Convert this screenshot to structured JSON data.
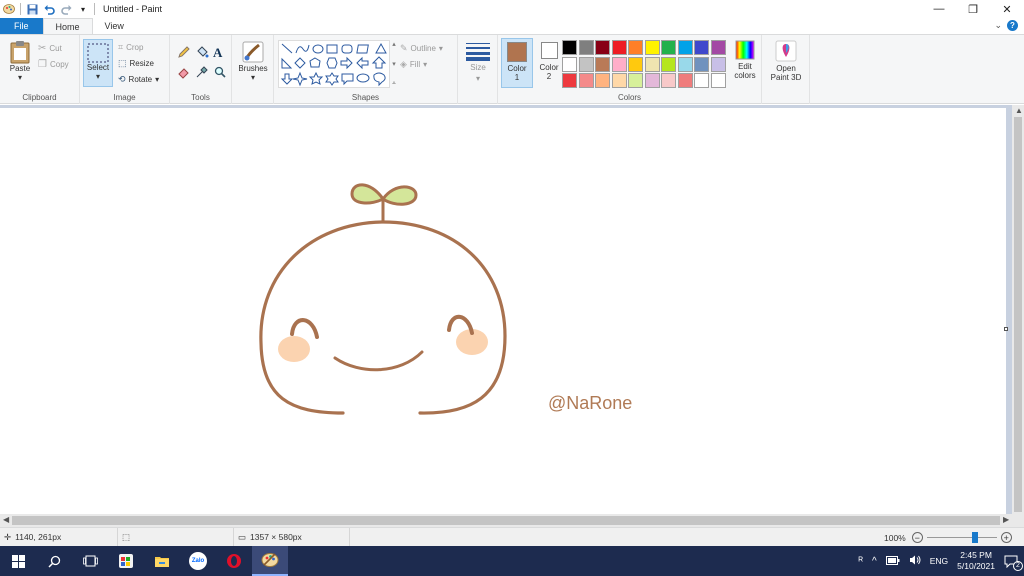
{
  "window": {
    "title": "Untitled - Paint",
    "minimize_glyph": "—",
    "restore_glyph": "❐",
    "close_glyph": "✕"
  },
  "tabs": {
    "file": "File",
    "home": "Home",
    "view": "View"
  },
  "ribbon": {
    "clipboard": {
      "label": "Clipboard",
      "paste": "Paste",
      "cut": "Cut",
      "copy": "Copy"
    },
    "image": {
      "label": "Image",
      "select": "Select",
      "crop": "Crop",
      "resize": "Resize",
      "rotate": "Rotate"
    },
    "tools": {
      "label": "Tools"
    },
    "brushes": {
      "label": "Brushes"
    },
    "shapes": {
      "label": "Shapes",
      "outline": "Outline",
      "fill": "Fill"
    },
    "size": {
      "label": "Size"
    },
    "colors": {
      "label": "Colors",
      "color1": "Color 1",
      "color1_hex": "#b0744f",
      "color2": "Color 2",
      "color2_hex": "#ffffff",
      "edit_colors": "Edit colors",
      "palette": [
        "#000000",
        "#7f7f7f",
        "#880015",
        "#ed1c24",
        "#ff7f27",
        "#fff200",
        "#22b14c",
        "#00a2e8",
        "#3f48cc",
        "#a349a4",
        "#ffffff",
        "#c3c3c3",
        "#b97a57",
        "#ffaec9",
        "#ffc90e",
        "#efe4b0",
        "#b5e61d",
        "#99d9ea",
        "#7092be",
        "#c8bfe7",
        "#ed3a3f",
        "#f48a8a",
        "#ffb380",
        "#ffd8a8",
        "#d7f09a",
        "#e3b8d9",
        "#f8c9c9",
        "#ef7c7c",
        "#ffffff",
        "#ffffff"
      ]
    },
    "paint3d": {
      "label": "Open Paint 3D"
    }
  },
  "canvas": {
    "watermark": "@NaRone",
    "drawing_colors": {
      "outline": "#a9724f",
      "leaf": "#d4e69a",
      "cheek": "#fbd3b0"
    }
  },
  "status": {
    "cursor_pos": "1140, 261px",
    "canvas_size": "1357 × 580px",
    "zoom": "100%",
    "zoom_level_pct": 70
  },
  "taskbar": {
    "lang": "ENG",
    "time": "2:45 PM",
    "date": "5/10/2021",
    "notif_count": "2",
    "zalo_label": "Zalo"
  }
}
